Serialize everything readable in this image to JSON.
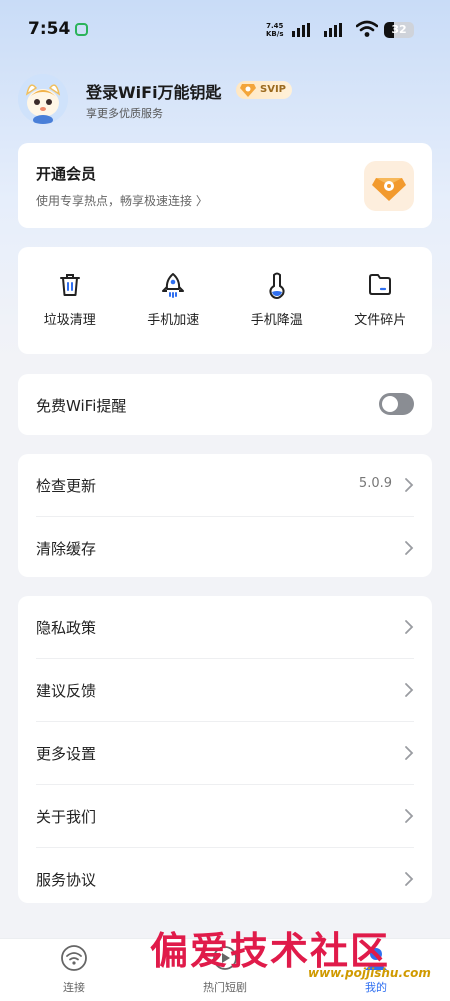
{
  "status_bar": {
    "time": "7:54",
    "net_speed_value": "7.45",
    "net_speed_unit": "KB/s",
    "battery": "32"
  },
  "profile": {
    "name": "登录WiFi万能钥匙",
    "badge": "SVIP",
    "subtitle": "享更多优质服务"
  },
  "vip_card": {
    "title": "开通会员",
    "subtitle": "使用专享热点，畅享极速连接 〉"
  },
  "tools": [
    {
      "label": "垃圾清理",
      "icon": "trash-icon"
    },
    {
      "label": "手机加速",
      "icon": "rocket-icon"
    },
    {
      "label": "手机降温",
      "icon": "thermometer-icon"
    },
    {
      "label": "文件碎片",
      "icon": "folder-icon"
    }
  ],
  "wifi_reminder": {
    "label": "免费WiFi提醒",
    "enabled": false
  },
  "settings_group1": [
    {
      "label": "检查更新",
      "value": "5.0.9"
    },
    {
      "label": "清除缓存"
    }
  ],
  "settings_group2": [
    {
      "label": "隐私政策"
    },
    {
      "label": "建议反馈"
    },
    {
      "label": "更多设置"
    },
    {
      "label": "关于我们"
    },
    {
      "label": "服务协议"
    }
  ],
  "tabbar": [
    {
      "label": "连接",
      "icon": "wifi-icon"
    },
    {
      "label": "热门短剧",
      "icon": "play-icon"
    },
    {
      "label": "我的",
      "icon": "user-icon",
      "active": true
    }
  ],
  "watermark": {
    "text": "偏爱技术社区",
    "url": "www.pojjishu.com"
  },
  "colors": {
    "accent": "#2f6ff0",
    "watermark": "#e01b4a"
  }
}
